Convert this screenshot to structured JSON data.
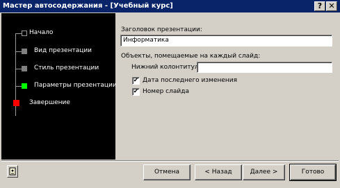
{
  "window": {
    "title": "Мастер автосодержания - [Учебный курс]",
    "help_glyph": "?",
    "close_glyph": "✕"
  },
  "steps": [
    {
      "label": "Начало",
      "color": "#000000"
    },
    {
      "label": "Вид презентации",
      "color": "#808080"
    },
    {
      "label": "Стиль презентации",
      "color": "#808080"
    },
    {
      "label": "Параметры презентации",
      "color": "#00ff00"
    },
    {
      "label": "Завершение",
      "color": "#ff0000"
    }
  ],
  "form": {
    "title_label": "Заголовок презентации:",
    "title_value": "Информатика",
    "objects_label": "Объекты, помещаемые на каждый слайд:",
    "footer_label": "Нижний колонтитул:",
    "footer_value": "",
    "date_label": "Дата последнего изменения",
    "date_checked": true,
    "slide_no_label": "Номер слайда",
    "slide_no_checked": true,
    "check_glyph": "✔"
  },
  "buttons": {
    "cancel": "Отмена",
    "back": "< Назад",
    "next": "Далее >",
    "finish": "Готово"
  }
}
